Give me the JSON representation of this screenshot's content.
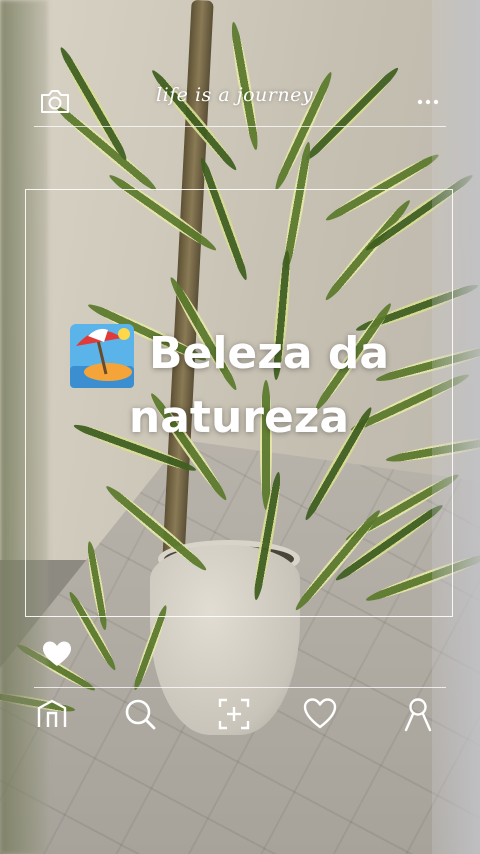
{
  "header": {
    "brand_text": "life is a journey",
    "camera_icon": "camera-icon",
    "more_icon": "more-dots-icon"
  },
  "post": {
    "emoji_icon": "beach-umbrella-icon",
    "title_line1": "Beleza da",
    "title_line2": "natureza",
    "like_icon": "heart-filled-icon"
  },
  "nav": {
    "items": [
      {
        "icon": "home-icon"
      },
      {
        "icon": "search-icon"
      },
      {
        "icon": "add-post-icon"
      },
      {
        "icon": "heart-outline-icon"
      },
      {
        "icon": "profile-icon"
      }
    ]
  },
  "colors": {
    "overlay_white": "#ffffff",
    "leaf_green": "#5b7a2c",
    "leaf_edge": "#e6e6a8"
  }
}
